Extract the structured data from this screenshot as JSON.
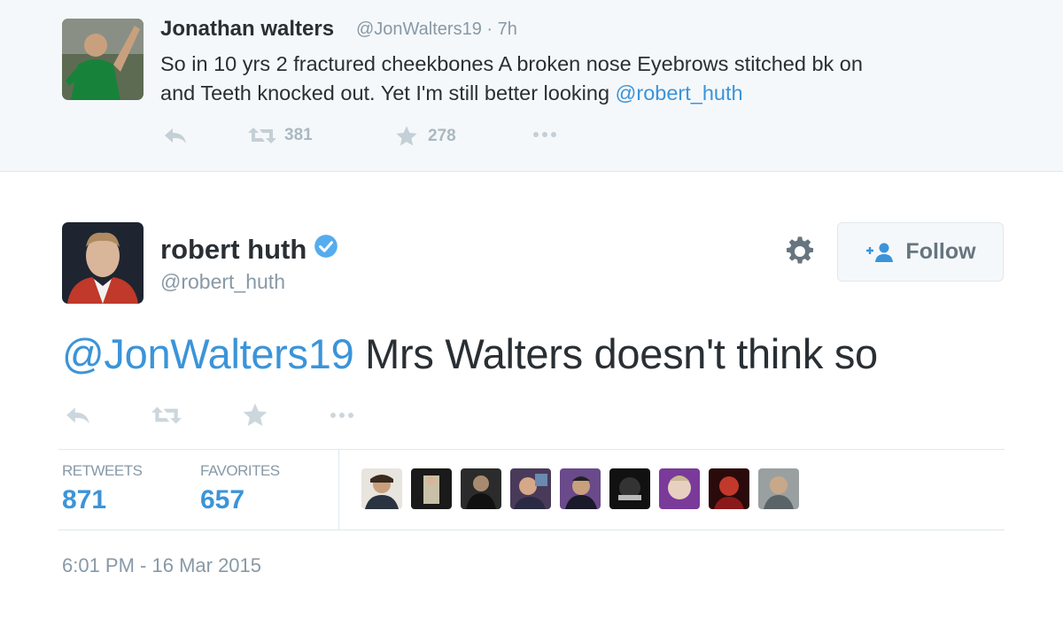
{
  "parent_tweet": {
    "author_name": "Jonathan walters",
    "meta": "@JonWalters19 · 7h",
    "text_line1": "So in 10 yrs 2 fractured cheekbones A broken nose Eyebrows stitched bk on",
    "text_line2": "and Teeth knocked out. Yet I'm still better looking ",
    "text_mention": "@robert_huth",
    "retweet_count": "381",
    "favorite_count": "278"
  },
  "main_tweet": {
    "author_name": "robert huth",
    "author_handle": "@robert_huth",
    "follow_label": "Follow",
    "mention": "@JonWalters19",
    "text": " Mrs Walters doesn't think so",
    "stats": {
      "retweets_label": "RETWEETS",
      "retweets_value": "871",
      "favorites_label": "FAVORITES",
      "favorites_value": "657"
    },
    "timestamp": "6:01 PM - 16 Mar 2015"
  },
  "colors": {
    "link": "#3b94d9",
    "text": "#292f33",
    "muted": "#8899a6",
    "verified": "#55acee"
  },
  "favoriter_avatars": [
    "avatar-1",
    "avatar-2",
    "avatar-3",
    "avatar-4",
    "avatar-5",
    "avatar-6",
    "avatar-7",
    "avatar-8",
    "avatar-9"
  ]
}
